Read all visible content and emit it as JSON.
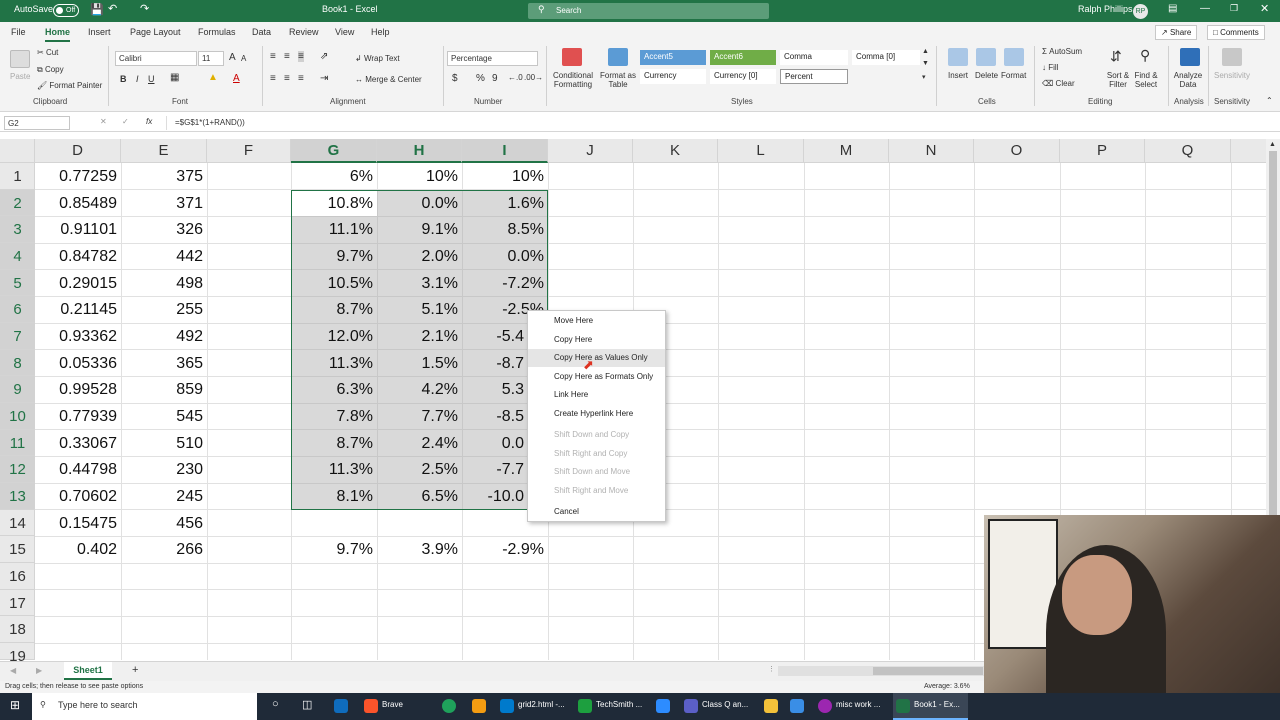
{
  "titlebar": {
    "autosave": "AutoSave",
    "toggle": "Off",
    "title": "Book1 - Excel",
    "search": "Search",
    "user": "Ralph Phillips",
    "initials": "RP"
  },
  "tabs": [
    "File",
    "Home",
    "Insert",
    "Page Layout",
    "Formulas",
    "Data",
    "Review",
    "View",
    "Help"
  ],
  "top_buttons": {
    "share": "Share",
    "comments": "Comments"
  },
  "ribbon": {
    "clipboard": {
      "paste": "Paste",
      "cut": "Cut",
      "copy": "Copy",
      "format_painter": "Format Painter",
      "label": "Clipboard"
    },
    "font": {
      "name": "Calibri",
      "size": "11",
      "bold": "B",
      "italic": "I",
      "underline": "U",
      "grow": "A",
      "shrink": "A",
      "fontcolor": "A",
      "label": "Font"
    },
    "alignment": {
      "wrap": "Wrap Text",
      "merge": "Merge & Center",
      "label": "Alignment"
    },
    "number": {
      "format": "Percentage",
      "dollar": "$",
      "percent": "%",
      "comma": "9",
      "label": "Number"
    },
    "styles": {
      "cond": "Conditional Formatting",
      "table": "Format as Table",
      "cells": [
        "Accent5",
        "Accent6",
        "Comma",
        "Comma [0]",
        "Currency",
        "Currency [0]",
        "Percent"
      ],
      "label": "Styles"
    },
    "cells": {
      "insert": "Insert",
      "delete": "Delete",
      "format": "Format",
      "label": "Cells"
    },
    "editing": {
      "autosum": "AutoSum",
      "fill": "Fill",
      "clear": "Clear",
      "sort": "Sort & Filter",
      "find": "Find & Select",
      "label": "Editing"
    },
    "analysis": {
      "analyze": "Analyze Data",
      "label": "Analysis"
    },
    "sensitivity": {
      "btn": "Sensitivity",
      "label": "Sensitivity"
    }
  },
  "formula_bar": {
    "namebox": "G2",
    "formula": "=$G$1*(1+RAND())",
    "fx": "fx"
  },
  "columns": [
    "D",
    "E",
    "F",
    "G",
    "H",
    "I",
    "J",
    "K",
    "L",
    "M",
    "N",
    "O",
    "P",
    "Q"
  ],
  "rows": [
    "1",
    "2",
    "3",
    "4",
    "5",
    "6",
    "7",
    "8",
    "9",
    "10",
    "11",
    "12",
    "13",
    "14",
    "15",
    "16",
    "17",
    "18",
    "19"
  ],
  "cells": {
    "D": [
      "0.77259",
      "0.85489",
      "0.91101",
      "0.84782",
      "0.29015",
      "0.21145",
      "0.93362",
      "0.05336",
      "0.99528",
      "0.77939",
      "0.33067",
      "0.44798",
      "0.70602",
      "0.15475",
      "0.402"
    ],
    "E": [
      "375",
      "371",
      "326",
      "442",
      "498",
      "255",
      "492",
      "365",
      "859",
      "545",
      "510",
      "230",
      "245",
      "456",
      "266"
    ],
    "G": [
      "6%",
      "10.8%",
      "11.1%",
      "9.7%",
      "10.5%",
      "8.7%",
      "12.0%",
      "11.3%",
      "6.3%",
      "7.8%",
      "8.7%",
      "11.3%",
      "8.1%",
      "",
      "9.7%"
    ],
    "H": [
      "10%",
      "0.0%",
      "9.1%",
      "2.0%",
      "3.1%",
      "5.1%",
      "2.1%",
      "1.5%",
      "4.2%",
      "7.7%",
      "2.4%",
      "2.5%",
      "6.5%",
      "",
      "3.9%"
    ],
    "I": [
      "10%",
      "1.6%",
      "8.5%",
      "0.0%",
      "-7.2%",
      "-2.5%",
      "-5.4",
      "-8.7",
      "5.3",
      "-8.5",
      "0.0",
      "-7.7",
      "-10.0",
      "",
      "-2.9%"
    ]
  },
  "context_menu": [
    {
      "label": "Move Here",
      "enabled": true
    },
    {
      "label": "Copy Here",
      "enabled": true
    },
    {
      "label": "Copy Here as Values Only",
      "enabled": true
    },
    {
      "label": "Copy Here as Formats Only",
      "enabled": true
    },
    {
      "label": "Link Here",
      "enabled": true
    },
    {
      "label": "Create Hyperlink Here",
      "enabled": true
    },
    {
      "label": "Shift Down and Copy",
      "enabled": false
    },
    {
      "label": "Shift Right and Copy",
      "enabled": false
    },
    {
      "label": "Shift Down and Move",
      "enabled": false
    },
    {
      "label": "Shift Right and Move",
      "enabled": false
    },
    {
      "label": "Cancel",
      "enabled": true
    }
  ],
  "sheet": {
    "tab": "Sheet1",
    "add": "+"
  },
  "status": {
    "left": "Drag cells; then release to see paste options",
    "average": "Average: 3.6%"
  },
  "taskbar": {
    "search": "Type here to search",
    "apps": [
      "Brave",
      "grid2.html -...",
      "TechSmith ...",
      "Class Q an...",
      "misc work ...",
      "Book1 - Ex..."
    ]
  },
  "colors": {
    "excel_green": "#217346",
    "selection_gray": "#aaaaaa",
    "accent5": "#5b9bd5",
    "accent6": "#70ad47"
  }
}
